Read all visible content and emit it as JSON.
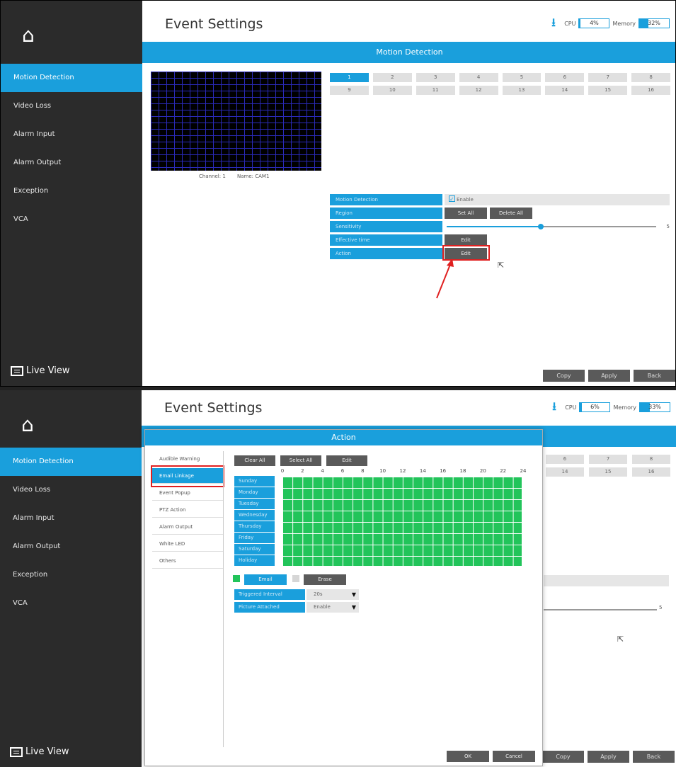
{
  "panel1": {
    "title": "Event Settings",
    "cpu_label": "CPU",
    "cpu_value": "4%",
    "cpu_fraction": 0.04,
    "memory_label": "Memory",
    "memory_value": "32%",
    "memory_fraction": 0.32,
    "banner": "Motion Detection",
    "sidebar": [
      {
        "label": "Motion Detection",
        "active": true
      },
      {
        "label": "Video Loss"
      },
      {
        "label": "Alarm Input"
      },
      {
        "label": "Alarm Output"
      },
      {
        "label": "Exception"
      },
      {
        "label": "VCA"
      }
    ],
    "live_view": "Live View",
    "channel_info": {
      "channel": "Channel: 1",
      "name": "Name: CAM1"
    },
    "channels": [
      "1",
      "2",
      "3",
      "4",
      "5",
      "6",
      "7",
      "8",
      "9",
      "10",
      "11",
      "12",
      "13",
      "14",
      "15",
      "16"
    ],
    "selected_channel": "1",
    "settings": {
      "motion_detection_label": "Motion Detection",
      "enable_label": "Enable",
      "region_label": "Region",
      "set_all": "Set All",
      "delete_all": "Delete All",
      "sensitivity_label": "Sensitivity",
      "sensitivity_value": "5",
      "sensitivity_fraction": 0.45,
      "effective_time_label": "Effective time",
      "effective_edit": "Edit",
      "action_label": "Action",
      "action_edit": "Edit"
    },
    "bottom": {
      "copy": "Copy",
      "apply": "Apply",
      "back": "Back"
    }
  },
  "panel2": {
    "title": "Event Settings",
    "cpu_label": "CPU",
    "cpu_value": "6%",
    "cpu_fraction": 0.06,
    "memory_label": "Memory",
    "memory_value": "33%",
    "memory_fraction": 0.33,
    "sidebar": [
      {
        "label": "Motion Detection",
        "active": true
      },
      {
        "label": "Video Loss"
      },
      {
        "label": "Alarm Input"
      },
      {
        "label": "Alarm Output"
      },
      {
        "label": "Exception"
      },
      {
        "label": "VCA"
      }
    ],
    "live_view": "Live View",
    "bg_channels": [
      "6",
      "7",
      "8",
      "14",
      "15",
      "16"
    ],
    "bg_sensitivity_value": "5",
    "bottom": {
      "copy": "Copy",
      "apply": "Apply",
      "back": "Back"
    },
    "dialog": {
      "title": "Action",
      "nav": [
        {
          "label": "Audible Warning"
        },
        {
          "label": "Email Linkage",
          "active": true
        },
        {
          "label": "Event Popup"
        },
        {
          "label": "PTZ Action"
        },
        {
          "label": "Alarm Output"
        },
        {
          "label": "White LED"
        },
        {
          "label": "Others"
        }
      ],
      "clear_all": "Clear All",
      "select_all": "Select All",
      "edit": "Edit",
      "hours": [
        "0",
        "2",
        "4",
        "6",
        "8",
        "10",
        "12",
        "14",
        "16",
        "18",
        "20",
        "22",
        "24"
      ],
      "days": [
        "Sunday",
        "Monday",
        "Tuesday",
        "Wednesday",
        "Thursday",
        "Friday",
        "Saturday",
        "Holiday"
      ],
      "email_btn": "Email",
      "erase_btn": "Erase",
      "triggered_interval_label": "Triggered Interval",
      "triggered_interval_value": "20s",
      "picture_attached_label": "Picture Attached",
      "picture_attached_value": "Enable",
      "ok": "OK",
      "cancel": "Cancel"
    }
  },
  "colors": {
    "accent": "#1a9fdc",
    "sidebar": "#2b2b2b",
    "schedule_green": "#22c45a",
    "highlight_red": "#e02020",
    "button_dark": "#5a5a5a"
  }
}
